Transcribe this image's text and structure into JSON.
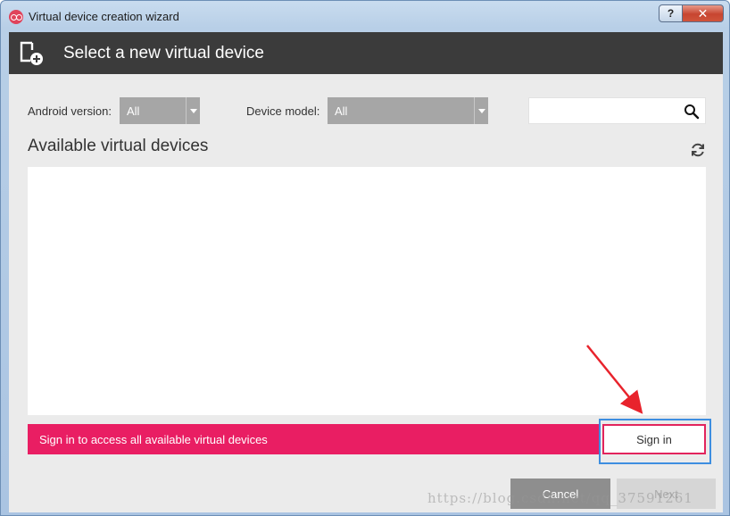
{
  "window": {
    "title": "Virtual device creation wizard",
    "help_label": "?",
    "close_label": "✕"
  },
  "header": {
    "title": "Select a new virtual device",
    "icon": "add-device-icon"
  },
  "filters": {
    "android_version_label": "Android version:",
    "android_version_value": "All",
    "device_model_label": "Device model:",
    "device_model_value": "All",
    "search_value": "",
    "search_icon": "search-icon"
  },
  "list": {
    "title": "Available virtual devices",
    "refresh_icon": "refresh-icon",
    "items": []
  },
  "banner": {
    "text": "Sign in to access all available virtual devices",
    "sign_in_label": "Sign in"
  },
  "footer": {
    "cancel_label": "Cancel",
    "next_label": "Next"
  },
  "annotation": {
    "arrow_color": "#e8232c",
    "highlight_color": "#3d8ee0"
  },
  "watermark": "https://blog.csdn.net/qq_37591261",
  "colors": {
    "header_bg": "#3b3b3b",
    "accent": "#e91e63",
    "client_bg": "#ebebeb"
  }
}
